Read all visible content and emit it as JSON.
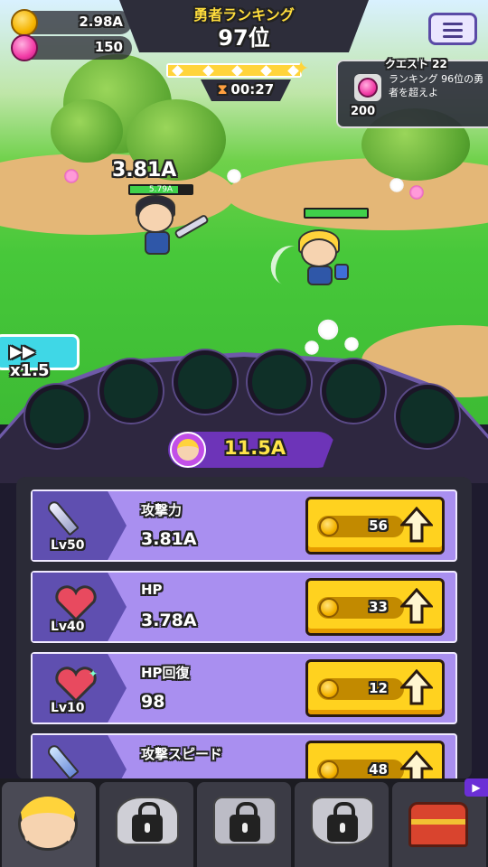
{
  "currencies": {
    "coins": "2.98A",
    "gems": "150"
  },
  "ranking": {
    "title": "勇者ランキング",
    "value": "97位"
  },
  "timer": "00:27",
  "quest": {
    "title": "クエスト 22",
    "description": "ランキング 96位の勇者を超えよ",
    "reward": "200"
  },
  "battle": {
    "damage_text": "3.81A",
    "player_hp": "5.79A"
  },
  "speed": {
    "label": "x1.5"
  },
  "power": {
    "value": "11.5A"
  },
  "upgrades": [
    {
      "name": "攻撃力",
      "level": "Lv50",
      "value": "3.81A",
      "cost": "56",
      "icon": "sword-icon"
    },
    {
      "name": "HP",
      "level": "Lv40",
      "value": "3.78A",
      "cost": "33",
      "icon": "heart-icon"
    },
    {
      "name": "HP回復",
      "level": "Lv10",
      "value": "98",
      "cost": "12",
      "icon": "heart-sparkle-icon"
    },
    {
      "name": "攻撃スピード",
      "level": "",
      "value": "",
      "cost": "48",
      "icon": "winged-sword-icon"
    }
  ],
  "nav": {
    "tabs": [
      "hero",
      "locked-helmet",
      "locked-wings",
      "locked-crest",
      "chest"
    ]
  },
  "colors": {
    "accent": "#ffd21f",
    "panel": "#a98ff0",
    "hp": "#3fd14a"
  }
}
